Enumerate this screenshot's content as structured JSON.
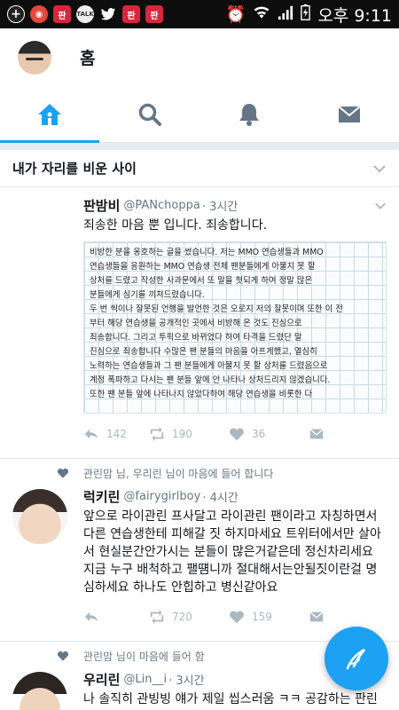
{
  "status_bar": {
    "time": "오후 9:11",
    "app_icons": [
      "plus-icon",
      "target-icon",
      "red-app-icon",
      "talk-icon",
      "bird-icon",
      "red-app-icon",
      "red-app-icon"
    ],
    "talk_label": "TALK"
  },
  "header": {
    "title": "홈"
  },
  "tabs": [
    {
      "name": "home",
      "icon": "home-icon",
      "active": true
    },
    {
      "name": "search",
      "icon": "search-icon",
      "active": false
    },
    {
      "name": "notifications",
      "icon": "bell-icon",
      "active": false
    },
    {
      "name": "messages",
      "icon": "mail-icon",
      "active": false
    }
  ],
  "section": {
    "title": "내가 자리를 비운 사이"
  },
  "tweets": [
    {
      "name": "판밤비",
      "handle": "@PANchoppa",
      "time": "· 3시간",
      "text": "죄송한 마음 뿐 입니다. 죄송합니다.",
      "note_lines": [
        "비방한 분을 옹호하는 글을 썼습니다. 저는 MMO 연습생들과 MMO",
        "연습생들을 응원하는 MMO 연습생 전체 팬분들에게 아물지 못 할",
        "상처를 드렸고 작성한 사과문에서 또 말을 헛되게 하여 정말 많은",
        "분들에게 심기를 끼쳐드렸습니다.",
        "두 번 씩이나 잘못된 언행을 발언한 것은 오로지 저의 잘못이며 또한 이 전",
        "부터 해당 연습생을 공개적인 곳에서 비방해 온 것도 진심으로",
        "죄송합니다. 그리고 투픽으로 바뀌었다 하여 타격을 드렸단 말",
        "진심으로 죄송합니다 수많은 팬 분들의 마음을 아프게했고, 열심히",
        "노력하는 연습생들과 그 팬 분들에게 아물지 못 할 상처를 드렸음으로",
        "계정 폭파하고 다시는 팬 분들 앞에 안 나타나 상처드리지 않겠습니다.",
        "또한 팬 분들 앞에 나타나지 않았다하여 해당 연습생을 비롯한 다"
      ],
      "replies": "142",
      "retweets": "190",
      "likes": "36"
    },
    {
      "liked_by": "관린맘 님, 우리린 님이 마음에 들어 합니다",
      "name": "럭키린",
      "handle": "@fairygirlboy",
      "time": "· 4시간",
      "text": "앞으로 라이관린 프사달고 라이관린 팬이라고 자칭하면서 다른 연습생한테 피해갈 짓 하지마세요 트위터에서만 살아서 현실분간안가시는 분들이 많은거같은데 정신차리세요 지금 누구 배척하고 팰떔니까 절대해서는안될짓이란걸 명심하세요 하나도 안힙하고 병신같아요",
      "replies": "",
      "retweets": "720",
      "likes": "159"
    },
    {
      "liked_by": "관린맘 님이 마음에 들어 함",
      "name": "우리린",
      "handle": "@Lin__i",
      "time": "· 3시간",
      "text": "나 솔직히 관빙빙 얘가 제일 씹스러움 ㅋㅋ 공감하는 판린애미들 많을거같은대"
    }
  ],
  "colors": {
    "accent": "#1da1f2",
    "muted": "#657786",
    "icon_gray": "#aab8c2"
  }
}
